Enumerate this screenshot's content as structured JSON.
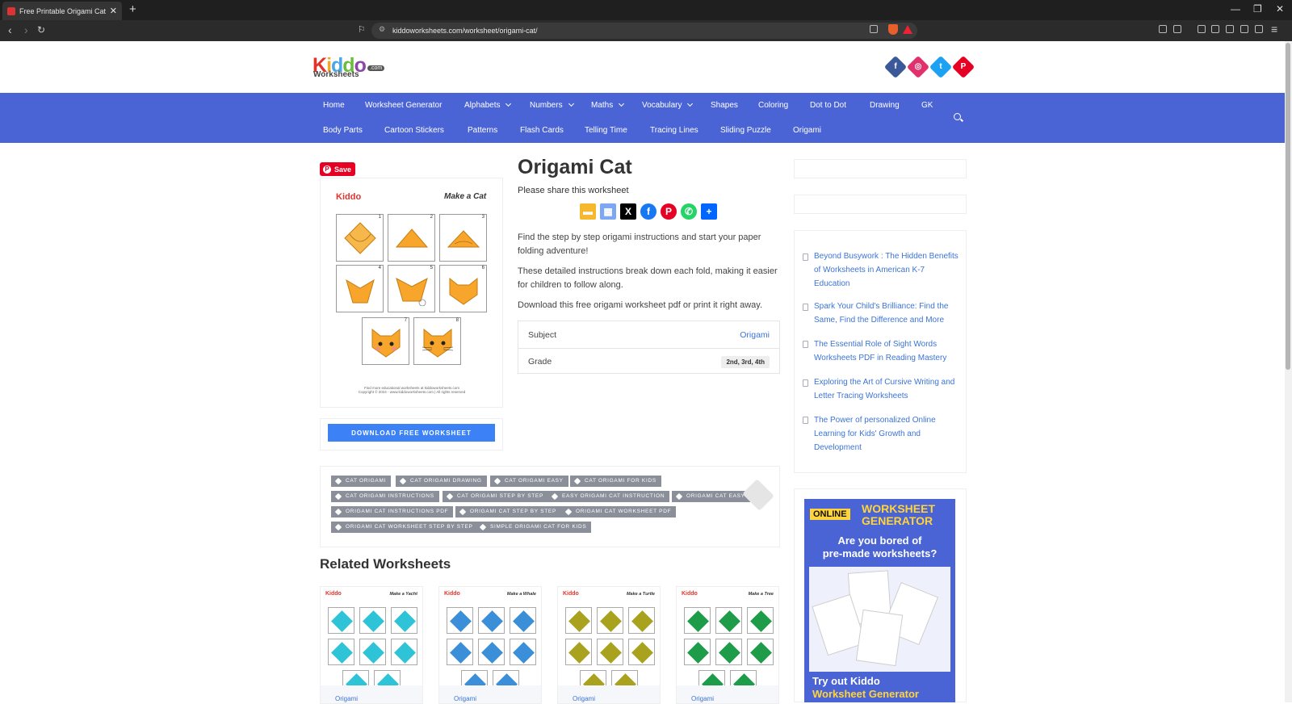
{
  "browser": {
    "tab_title": "Free Printable Origami Cat Worl",
    "url": "kiddoworksheets.com/worksheet/origami-cat/"
  },
  "site": {
    "logo_word": "Kiddo",
    "logo_sub": "Worksheets",
    "logo_com": ".com",
    "social": [
      "facebook-icon",
      "instagram-icon",
      "twitter-icon",
      "pinterest-icon"
    ],
    "colors": {
      "nav": "#4a64d5",
      "link": "#3c74d5",
      "download": "#3c82f6",
      "pinterest": "#e60023"
    }
  },
  "nav": {
    "row1": [
      "Home",
      "Worksheet Generator",
      "Alphabets",
      "Numbers",
      "Maths",
      "Vocabulary",
      "Shapes",
      "Coloring",
      "Dot to Dot",
      "Drawing",
      "GK"
    ],
    "row2": [
      "Body Parts",
      "Cartoon Stickers",
      "Patterns",
      "Flash Cards",
      "Telling Time",
      "Tracing Lines",
      "Sliding Puzzle",
      "Origami"
    ]
  },
  "worksheet": {
    "save_label": "Save",
    "preview_title": "Make a Cat",
    "preview_logo": "Kiddo",
    "steps": [
      "1",
      "2",
      "3",
      "4",
      "5",
      "6",
      "7",
      "8"
    ],
    "footer_line1": "Find more educational worksheets at kiddoworksheets.com",
    "footer_line2": "Copyright © 2024 - www.kiddoworksheets.com | All rights reserved",
    "download_label": "DOWNLOAD FREE WORKSHEET"
  },
  "article": {
    "title": "Origami Cat",
    "share_label": "Please share this worksheet",
    "para1": "Find the step by step origami instructions and start your paper folding adventure!",
    "para2": "These detailed instructions break down each fold, making it easier for children to follow along.",
    "para3": "Download this free origami worksheet pdf or print it right away.",
    "subject_label": "Subject",
    "subject_value": "Origami",
    "grade_label": "Grade",
    "grade_value": "2nd, 3rd, 4th"
  },
  "tags": [
    "CAT ORIGAMI",
    "CAT ORIGAMI DRAWING",
    "CAT ORIGAMI EASY",
    "CAT ORIGAMI FOR KIDS",
    "CAT ORIGAMI INSTRUCTIONS",
    "CAT ORIGAMI STEP BY STEP",
    "EASY ORIGAMI CAT INSTRUCTION",
    "ORIGAMI CAT EASY",
    "ORIGAMI CAT INSTRUCTIONS PDF",
    "ORIGAMI CAT STEP BY STEP",
    "ORIGAMI CAT WORKSHEET PDF",
    "ORIGAMI CAT WORKSHEET STEP BY STEP",
    "SIMPLE ORIGAMI CAT FOR KIDS"
  ],
  "related": {
    "heading": "Related Worksheets",
    "items": [
      {
        "title": "Make a Yacht",
        "category": "Origami",
        "color": "#2fc3d8"
      },
      {
        "title": "Make a Whale",
        "category": "Origami",
        "color": "#3a8fd8"
      },
      {
        "title": "Make a Turtle",
        "category": "Origami",
        "color": "#a9a21e"
      },
      {
        "title": "Make a Tree",
        "category": "Origami",
        "color": "#1f9c4a"
      }
    ]
  },
  "sidebar": {
    "posts": [
      "Beyond Busywork : The Hidden Benefits of Worksheets in American K-7 Education",
      "Spark Your Child's Brilliance: Find the Same, Find the Difference and More",
      "The Essential Role of Sight Words Worksheets PDF in Reading Mastery",
      "Exploring the Art of Cursive Writing and Letter Tracing Worksheets",
      "The Power of personalized Online Learning for Kids' Growth and Development"
    ],
    "ad": {
      "badge": "ONLINE",
      "heading_line1": "WORKSHEET",
      "heading_line2": "GENERATOR",
      "question_line1": "Are you bored of",
      "question_line2": "pre-made worksheets?",
      "cta_line1": "Try out Kiddo",
      "cta_line2": "Worksheet Generator"
    }
  }
}
